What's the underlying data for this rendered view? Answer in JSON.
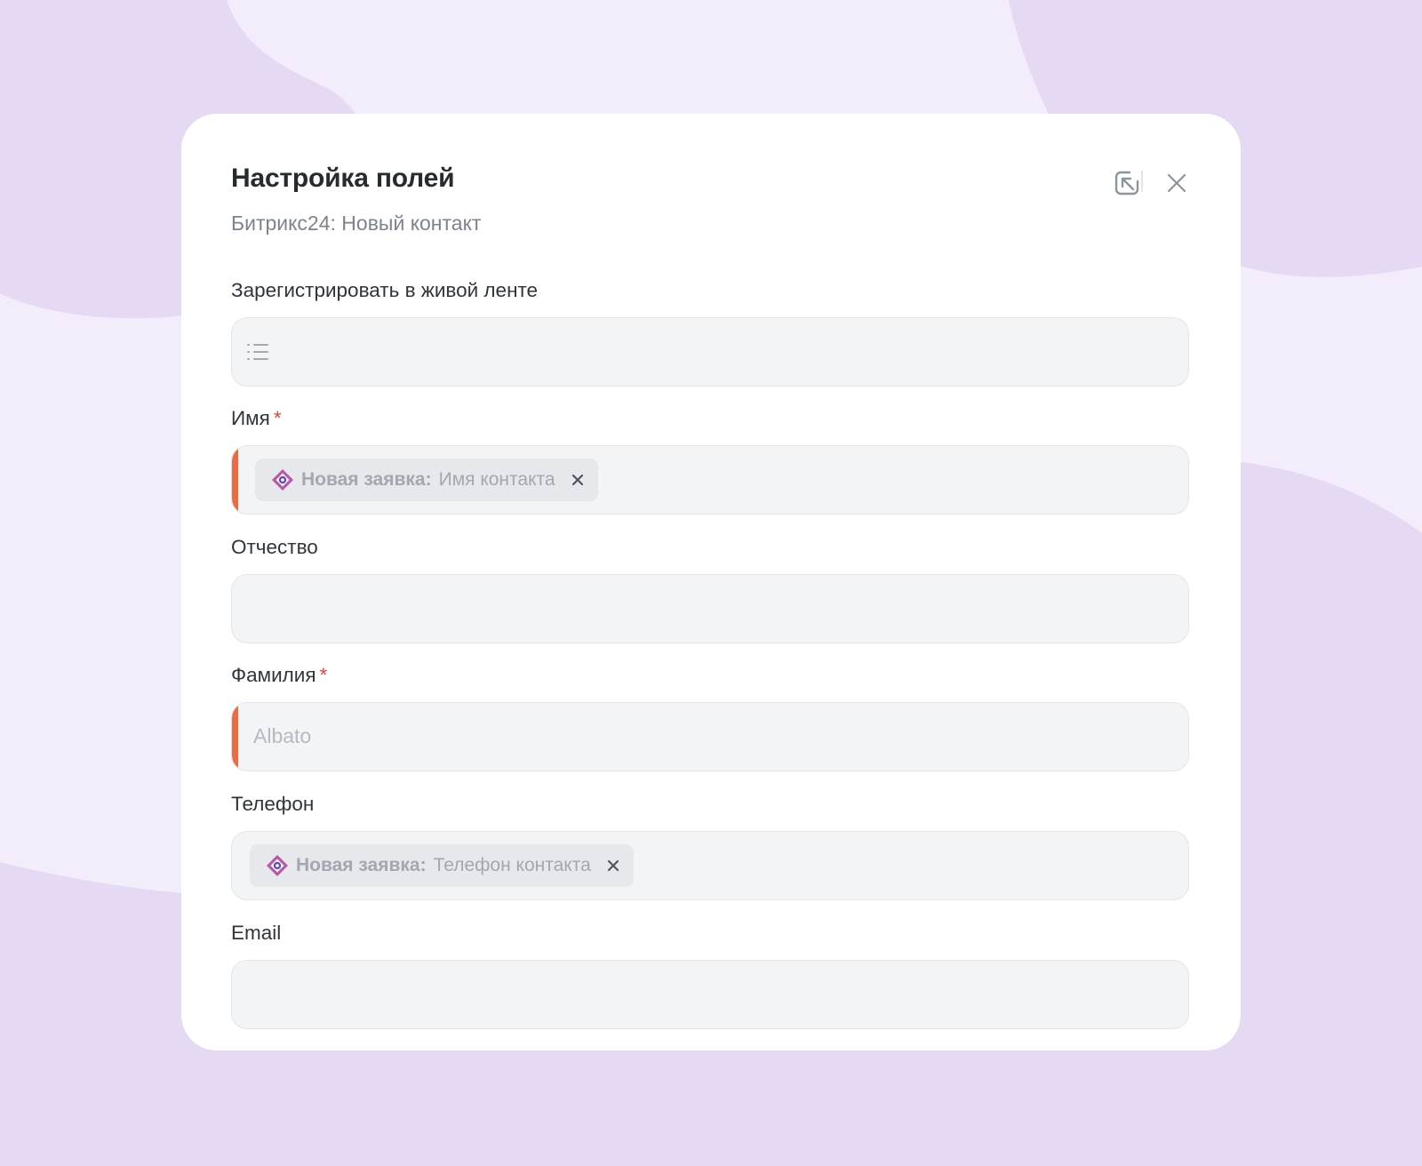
{
  "modal": {
    "title": "Настройка полей",
    "subtitle": "Битрикс24: Новый контакт",
    "collapse_icon": "collapse-arrow-icon",
    "close_icon": "close-icon"
  },
  "fields": {
    "livefeed": {
      "label": "Зарегистрировать в живой ленте",
      "icon": "list-icon"
    },
    "name": {
      "label": "Имя",
      "required": "*",
      "chip": {
        "source": "Новая заявка:",
        "value": "Имя контакта"
      }
    },
    "patronymic": {
      "label": "Отчество"
    },
    "lastname": {
      "label": "Фамилия",
      "required": "*",
      "value": "Albato"
    },
    "phone": {
      "label": "Телефон",
      "chip": {
        "source": "Новая заявка:",
        "value": "Телефон контакта"
      }
    },
    "email": {
      "label": "Email"
    }
  },
  "colors": {
    "background": "#e6d9f4",
    "modal": "#ffffff",
    "required_marker": "#e0433b",
    "error_bar": "#ee6a43",
    "field_bg": "#f3f4f6"
  }
}
